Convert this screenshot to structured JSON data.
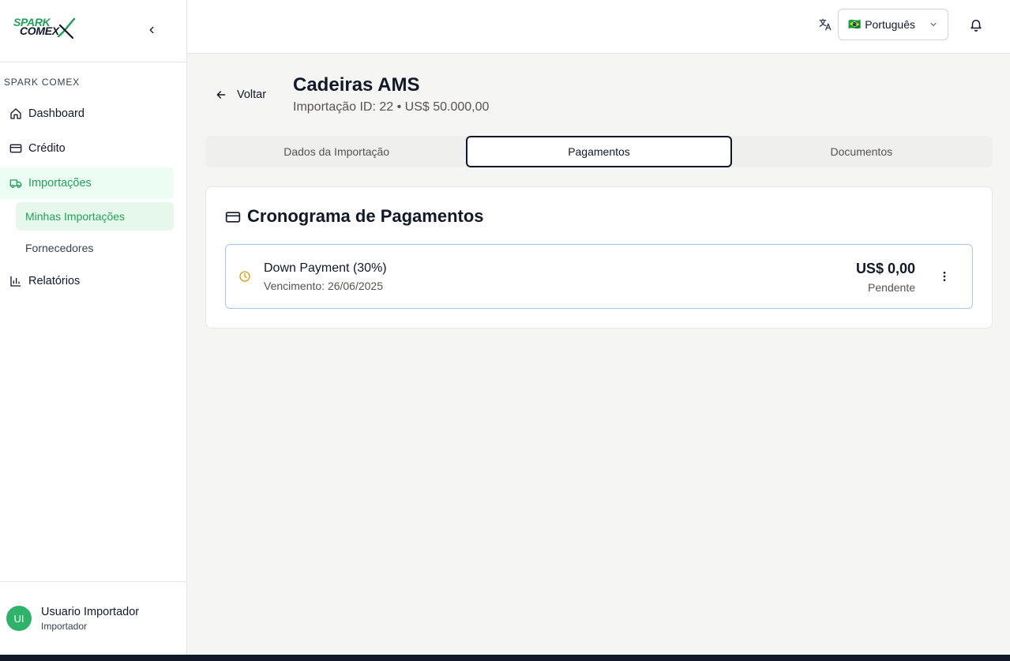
{
  "app": {
    "logo_line1": "SPARK",
    "logo_line2": "COMEX"
  },
  "sidebar": {
    "section_label": "SPARK COMEX",
    "items": [
      {
        "label": "Dashboard",
        "icon": "home-icon"
      },
      {
        "label": "Crédito",
        "icon": "credit-card-icon"
      },
      {
        "label": "Importações",
        "icon": "truck-icon"
      },
      {
        "label": "Relatórios",
        "icon": "bar-chart-icon"
      }
    ],
    "sub_items": [
      {
        "label": "Minhas Importações"
      },
      {
        "label": "Fornecedores"
      }
    ],
    "user": {
      "initials": "UI",
      "name": "Usuario Importador",
      "role": "Importador"
    }
  },
  "header": {
    "language": {
      "flag": "🇧🇷",
      "label": "Português"
    }
  },
  "page": {
    "back_label": "Voltar",
    "title": "Cadeiras AMS",
    "subtitle": "Importação ID: 22 • US$ 50.000,00",
    "tabs": [
      {
        "label": "Dados da Importação"
      },
      {
        "label": "Pagamentos"
      },
      {
        "label": "Documentos"
      }
    ],
    "active_tab": "Pagamentos"
  },
  "payments": {
    "card_title": "Cronograma de Pagamentos",
    "rows": [
      {
        "name": "Down Payment (30%)",
        "due": "Vencimento: 26/06/2025",
        "amount": "US$ 0,00",
        "status": "Pendente"
      }
    ]
  },
  "colors": {
    "brand": "#22a05a",
    "active_bg": "#ecfdf3",
    "pending": "#d4a017",
    "row_border": "#a9c7ef"
  }
}
